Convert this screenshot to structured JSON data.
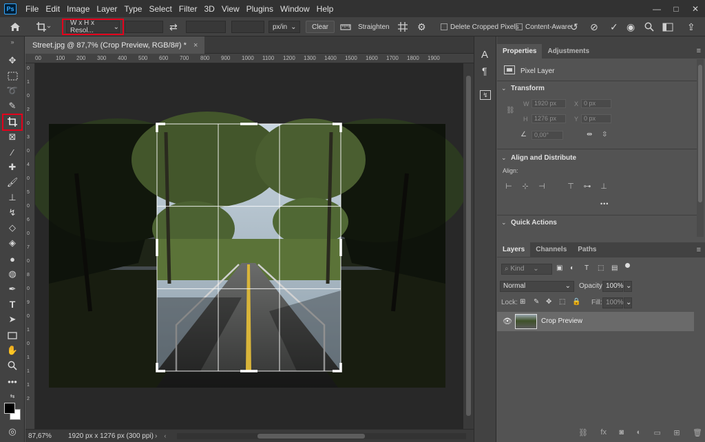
{
  "menu": {
    "logo": "Ps",
    "items": [
      "File",
      "Edit",
      "Image",
      "Layer",
      "Type",
      "Select",
      "Filter",
      "3D",
      "View",
      "Plugins",
      "Window",
      "Help"
    ]
  },
  "window_controls": {
    "minimize": "—",
    "maximize": "□",
    "close": "✕"
  },
  "options": {
    "preset": "W x H x Resol...",
    "unit": "px/in",
    "clear_label": "Clear",
    "straighten_label": "Straighten",
    "delete_cropped_label": "Delete Cropped Pixels",
    "content_aware_label": "Content-Aware"
  },
  "document": {
    "tab_title": "Street.jpg @ 87,7% (Crop Preview, RGB/8#) *",
    "close_glyph": "×",
    "ruler_h": [
      "00",
      "100",
      "200",
      "300",
      "400",
      "500",
      "600",
      "700",
      "800",
      "900",
      "1000",
      "1100",
      "1200",
      "1300",
      "1400",
      "1500",
      "1600",
      "1700",
      "1800",
      "1900"
    ],
    "ruler_v": [
      "0",
      "1",
      "0",
      "2",
      "0",
      "3",
      "0",
      "4",
      "0",
      "5",
      "0",
      "6",
      "0",
      "7",
      "0",
      "8",
      "0",
      "9",
      "0",
      "1",
      "0",
      "1",
      "1",
      "1",
      "2"
    ],
    "zoom": "87,67%",
    "doc_info": "1920 px x 1276 px (300 ppi)"
  },
  "properties": {
    "tab_properties": "Properties",
    "tab_adjustments": "Adjustments",
    "pixel_layer": "Pixel Layer",
    "transform_title": "Transform",
    "w_label": "W",
    "w_value": "1920 px",
    "h_label": "H",
    "h_value": "1276 px",
    "x_label": "X",
    "x_value": "0 px",
    "y_label": "Y",
    "y_value": "0 px",
    "angle_value": "0,00°",
    "align_title": "Align and Distribute",
    "align_label": "Align:",
    "more_glyph": "•••",
    "quick_actions_title": "Quick Actions"
  },
  "layers": {
    "tab_layers": "Layers",
    "tab_channels": "Channels",
    "tab_paths": "Paths",
    "kind_label": "Kind",
    "blend_mode": "Normal",
    "opacity_label": "Opacity:",
    "opacity_value": "100%",
    "lock_label": "Lock:",
    "fill_label": "Fill:",
    "fill_value": "100%",
    "layer_name": "Crop Preview"
  },
  "colors": {
    "accent_red": "#e3001b",
    "road_line": "#d9b53a"
  }
}
